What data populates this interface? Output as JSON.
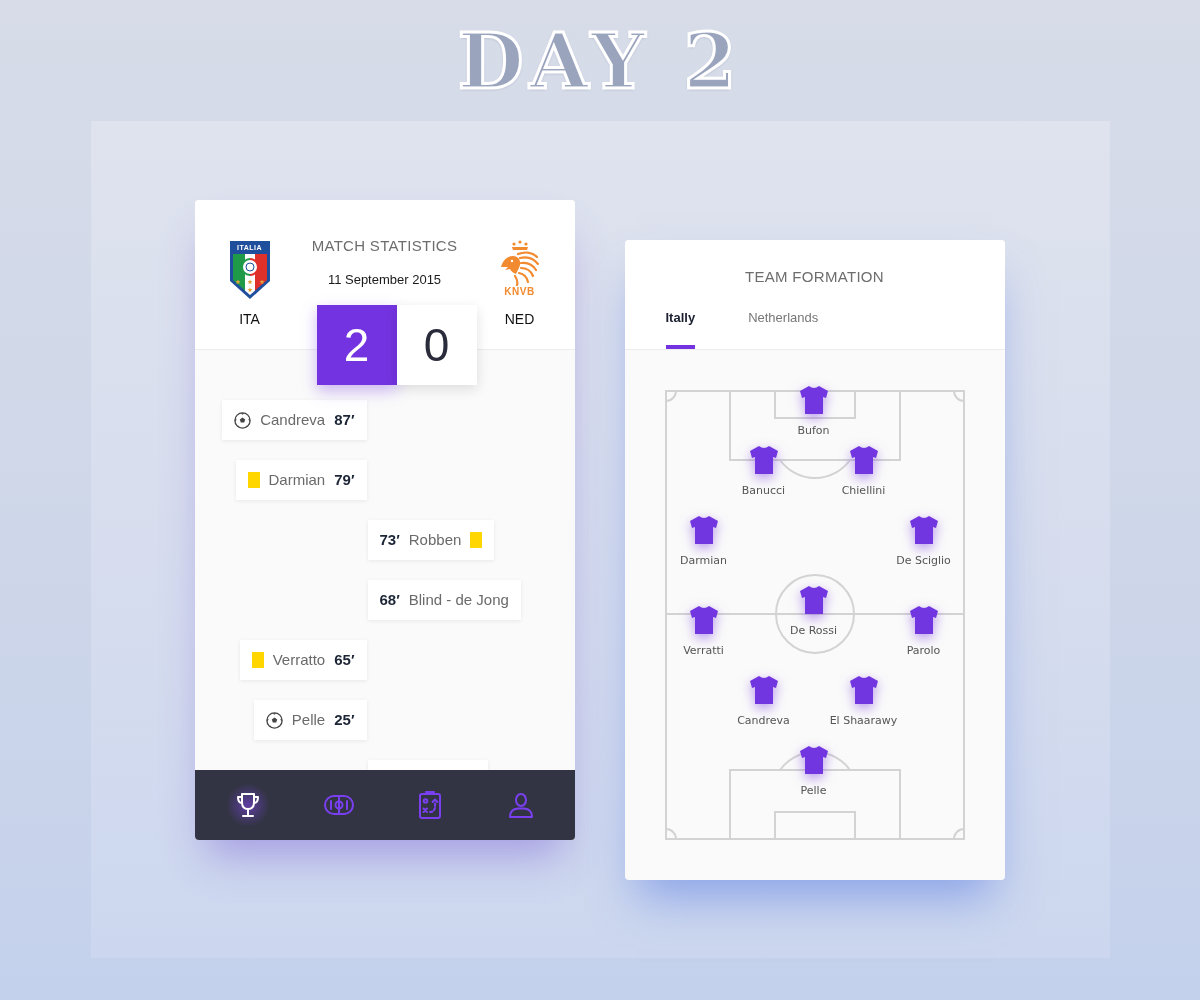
{
  "title": "DAY 2",
  "match_card": {
    "title": "MATCH STATISTICS",
    "date": "11 September 2015",
    "home": {
      "crest_text": "ITALIA",
      "code": "ITA",
      "score": "2"
    },
    "away": {
      "crest_text": "KNVB",
      "code": "NED",
      "score": "0"
    },
    "events": [
      {
        "home_team": true,
        "kind": "goal",
        "player": "Candreva",
        "minute": "87′"
      },
      {
        "home_team": true,
        "kind": "yellow_card",
        "player": "Darmian",
        "minute": "79′"
      },
      {
        "home_team": false,
        "kind": "yellow_card",
        "player": "Robben",
        "minute": "73′"
      },
      {
        "home_team": false,
        "kind": "substitution",
        "player": "Blind - de Jong",
        "minute": "68′"
      },
      {
        "home_team": true,
        "kind": "yellow_card",
        "player": "Verratto",
        "minute": "65′"
      },
      {
        "home_team": true,
        "kind": "goal",
        "player": "Pelle",
        "minute": "25′"
      },
      {
        "home_team": false
      }
    ],
    "nav": [
      {
        "selected": true
      },
      {
        "selected": false
      },
      {
        "selected": false
      },
      {
        "selected": false
      }
    ]
  },
  "formation_card": {
    "title": "TEAM FORMATION",
    "tabs": [
      {
        "label": "Itally",
        "selected": true
      },
      {
        "label": "Netherlands",
        "selected": false
      }
    ],
    "players": [
      "Bufon",
      "Banucci",
      "Chiellini",
      "Darmian",
      "De Sciglio",
      "De Rossi",
      "Verratti",
      "Parolo",
      "Candreva",
      "El Shaarawy",
      "Pelle"
    ]
  }
}
